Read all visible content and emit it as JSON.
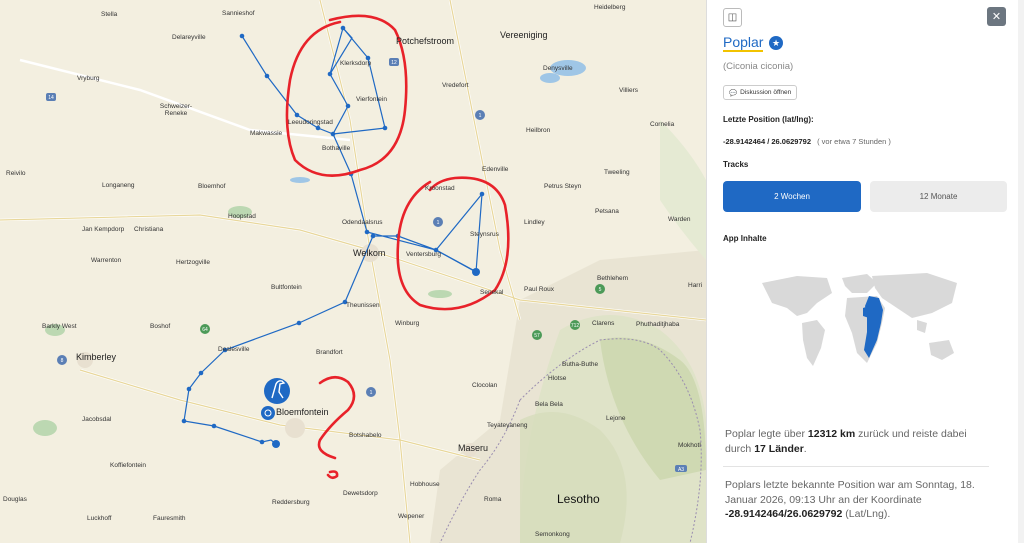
{
  "panel": {
    "bird_name": "Poplar",
    "latin_name": "(Ciconia ciconia)",
    "discuss_label": "Diskussion öffnen",
    "position_label": "Letzte Position (lat/lng):",
    "coords_value": "-28.9142464 / 26.0629792",
    "coords_note": "( vor etwa 7 Stunden )",
    "tracks_label": "Tracks",
    "tab_2w": "2 Wochen",
    "tab_12m": "12 Monate",
    "app_content_label": "App Inhalte",
    "stats1_a": "Poplar legte über ",
    "stats1_km": "12312 km",
    "stats1_b": " zurück und reiste dabei durch ",
    "stats1_countries": "17 Länder",
    "stats1_c": ".",
    "stats2_a": "Poplars letzte bekannte Position war am Sonntag, 18. Januar 2026, 09:13 Uhr an der Koordinate ",
    "stats2_coords": "-28.9142464/26.0629792",
    "stats2_b": " (Lat/Lng).",
    "accent_color": "#1f69c4",
    "underline_color": "#f2c300"
  },
  "map": {
    "towns": [
      {
        "name": "Stella",
        "size": "s"
      },
      {
        "name": "Sannieshof",
        "size": "s"
      },
      {
        "name": "Delareyville",
        "size": "s"
      },
      {
        "name": "Vryburg",
        "size": "s"
      },
      {
        "name": "Schweizer-Reneke",
        "size": "s"
      },
      {
        "name": "Makwassie",
        "size": "s"
      },
      {
        "name": "Leeudoringstad",
        "size": "s"
      },
      {
        "name": "Klerksdorp",
        "size": "s"
      },
      {
        "name": "Potchefstroom",
        "size": "b"
      },
      {
        "name": "Vereeniging",
        "size": "b"
      },
      {
        "name": "Heidelberg",
        "size": "s"
      },
      {
        "name": "Denysville",
        "size": "s"
      },
      {
        "name": "Villiers",
        "size": "s"
      },
      {
        "name": "Vierfontein",
        "size": "s"
      },
      {
        "name": "Vredefort",
        "size": "s"
      },
      {
        "name": "Heilbron",
        "size": "s"
      },
      {
        "name": "Cornelia",
        "size": "s"
      },
      {
        "name": "Bothaville",
        "size": "s"
      },
      {
        "name": "Reivilo",
        "size": "s"
      },
      {
        "name": "Bloemhof",
        "size": "s"
      },
      {
        "name": "Longaneng",
        "size": "s"
      },
      {
        "name": "Kroonstad",
        "size": "s"
      },
      {
        "name": "Edenville",
        "size": "s"
      },
      {
        "name": "Petrus Steyn",
        "size": "s"
      },
      {
        "name": "Tweeling",
        "size": "s"
      },
      {
        "name": "Petsana",
        "size": "s"
      },
      {
        "name": "Warden",
        "size": "s"
      },
      {
        "name": "Hoopstad",
        "size": "s"
      },
      {
        "name": "Odendaalsrus",
        "size": "s"
      },
      {
        "name": "Jan Kempdorp",
        "size": "s"
      },
      {
        "name": "Christiana",
        "size": "s"
      },
      {
        "name": "Steynsrus",
        "size": "s"
      },
      {
        "name": "Lindley",
        "size": "s"
      },
      {
        "name": "Welkom",
        "size": "b"
      },
      {
        "name": "Ventersburg",
        "size": "s"
      },
      {
        "name": "Warrenton",
        "size": "s"
      },
      {
        "name": "Hertzogville",
        "size": "s"
      },
      {
        "name": "Bethlehem",
        "size": "s"
      },
      {
        "name": "Harri",
        "size": "s"
      },
      {
        "name": "Bultfontein",
        "size": "s"
      },
      {
        "name": "Senekal",
        "size": "s"
      },
      {
        "name": "Paul Roux",
        "size": "s"
      },
      {
        "name": "Theunissen",
        "size": "s"
      },
      {
        "name": "Barkly West",
        "size": "s"
      },
      {
        "name": "Boshof",
        "size": "s"
      },
      {
        "name": "Winburg",
        "size": "s"
      },
      {
        "name": "Clarens",
        "size": "s"
      },
      {
        "name": "Phuthaditjhaba",
        "size": "s"
      },
      {
        "name": "Dealesville",
        "size": "s"
      },
      {
        "name": "Kimberley",
        "size": "b"
      },
      {
        "name": "Brandfort",
        "size": "s"
      },
      {
        "name": "Butha-Buthe",
        "size": "s"
      },
      {
        "name": "Hlotse",
        "size": "s"
      },
      {
        "name": "Clocolan",
        "size": "s"
      },
      {
        "name": "Bela Bela",
        "size": "s"
      },
      {
        "name": "Lejone",
        "size": "s"
      },
      {
        "name": "Bloemfontein",
        "size": "b"
      },
      {
        "name": "Teyateyaneng",
        "size": "s"
      },
      {
        "name": "Jacobsdal",
        "size": "s"
      },
      {
        "name": "Botshabelo",
        "size": "s"
      },
      {
        "name": "Maseru",
        "size": "b"
      },
      {
        "name": "Mokhotl",
        "size": "s"
      },
      {
        "name": "Koffiefontein",
        "size": "s"
      },
      {
        "name": "Hobhouse",
        "size": "s"
      },
      {
        "name": "Lesotho",
        "size": "h"
      },
      {
        "name": "Dewetsdorp",
        "size": "s"
      },
      {
        "name": "Roma",
        "size": "s"
      },
      {
        "name": "Reddersburg",
        "size": "s"
      },
      {
        "name": "Luckhoff",
        "size": "s"
      },
      {
        "name": "Fauresmith",
        "size": "s"
      },
      {
        "name": "Wepener",
        "size": "s"
      },
      {
        "name": "Semonkong",
        "size": "s"
      },
      {
        "name": "Douglas",
        "size": "s"
      }
    ],
    "road_badges": [
      "14",
      "12",
      "1",
      "1",
      "5",
      "8",
      "57",
      "64",
      "8",
      "1",
      "712",
      "A3"
    ],
    "icons": [
      "stork-marker-icon",
      "locate-icon"
    ]
  }
}
